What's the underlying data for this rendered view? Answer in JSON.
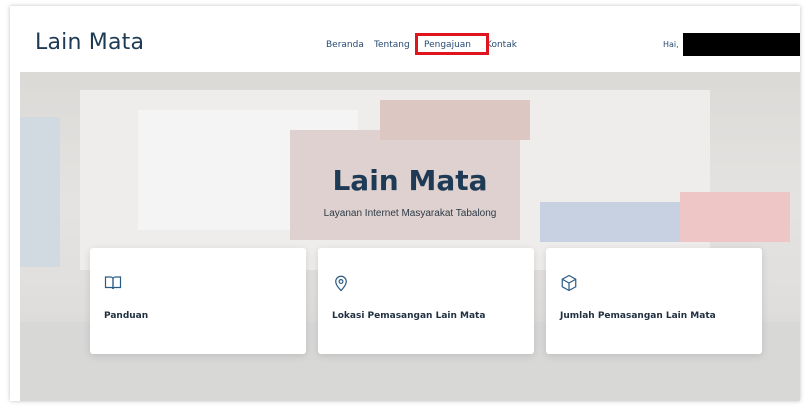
{
  "brand": "Lain Mata",
  "nav": {
    "items": [
      "Beranda",
      "Tentang",
      "Pengajuan",
      "Kontak"
    ]
  },
  "greeting": "Hai,",
  "hero": {
    "title": "Lain Mata",
    "subtitle": "Layanan Internet Masyarakat Tabalong"
  },
  "cards": [
    {
      "label": "Panduan",
      "icon": "book-icon"
    },
    {
      "label": "Lokasi Pemasangan Lain Mata",
      "icon": "location-pin-icon"
    },
    {
      "label": "Jumlah Pemasangan Lain Mata",
      "icon": "box-icon"
    }
  ],
  "colors": {
    "brand": "#1f3a55",
    "nav_text": "#274b73",
    "highlight_box": "#e0141e",
    "icon": "#2a5b86"
  }
}
